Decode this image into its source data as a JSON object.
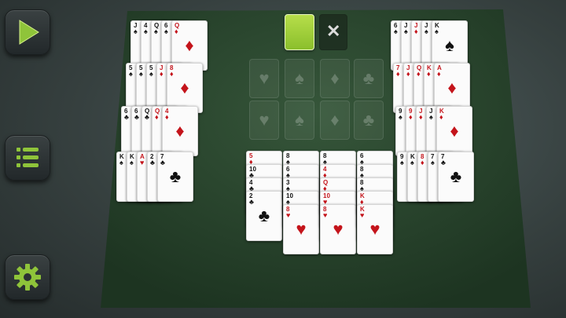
{
  "sidebar": {
    "buttons": [
      {
        "name": "play-button",
        "icon": "play-icon"
      },
      {
        "name": "menu-button",
        "icon": "list-icon"
      },
      {
        "name": "settings-button",
        "icon": "gear-icon"
      }
    ]
  },
  "colors": {
    "accent": "#8fc43a",
    "felt": "#2a4a2b",
    "card_red": "#c4141b"
  },
  "top_controls": {
    "deal_icon": "green-card-back-icon",
    "clear_icon": "close-icon",
    "clear_glyph": "✕"
  },
  "left_rows": [
    {
      "cards": [
        {
          "r": "J",
          "s": "♠"
        },
        {
          "r": "4",
          "s": "♠"
        },
        {
          "r": "Q",
          "s": "♠"
        },
        {
          "r": "6",
          "s": "♠"
        },
        {
          "r": "Q",
          "s": "♦"
        }
      ]
    },
    {
      "cards": [
        {
          "r": "5",
          "s": "♠"
        },
        {
          "r": "5",
          "s": "♠"
        },
        {
          "r": "5",
          "s": "♠"
        },
        {
          "r": "J",
          "s": "♦"
        },
        {
          "r": "8",
          "s": "♦"
        }
      ]
    },
    {
      "cards": [
        {
          "r": "6",
          "s": "♣"
        },
        {
          "r": "6",
          "s": "♣"
        },
        {
          "r": "Q",
          "s": "♣"
        },
        {
          "r": "Q",
          "s": "♦"
        },
        {
          "r": "4",
          "s": "♦"
        }
      ]
    },
    {
      "cards": [
        {
          "r": "K",
          "s": "♠"
        },
        {
          "r": "K",
          "s": "♠"
        },
        {
          "r": "A",
          "s": "♥"
        },
        {
          "r": "2",
          "s": "♣"
        },
        {
          "r": "7",
          "s": "♣"
        }
      ]
    }
  ],
  "right_rows": [
    {
      "cards": [
        {
          "r": "6",
          "s": "♠"
        },
        {
          "r": "J",
          "s": "♠"
        },
        {
          "r": "J",
          "s": "♦"
        },
        {
          "r": "J",
          "s": "♠"
        },
        {
          "r": "K",
          "s": "♠"
        }
      ]
    },
    {
      "cards": [
        {
          "r": "7",
          "s": "♦"
        },
        {
          "r": "J",
          "s": "♦"
        },
        {
          "r": "Q",
          "s": "♦"
        },
        {
          "r": "K",
          "s": "♦"
        },
        {
          "r": "A",
          "s": "♦"
        }
      ]
    },
    {
      "cards": [
        {
          "r": "9",
          "s": "♠"
        },
        {
          "r": "9",
          "s": "♦"
        },
        {
          "r": "J",
          "s": "♦"
        },
        {
          "r": "J",
          "s": "♠"
        },
        {
          "r": "K",
          "s": "♦"
        }
      ]
    },
    {
      "cards": [
        {
          "r": "9",
          "s": "♠"
        },
        {
          "r": "K",
          "s": "♠"
        },
        {
          "r": "8",
          "s": "♦"
        },
        {
          "r": "7",
          "s": "♠"
        },
        {
          "r": "7",
          "s": "♣"
        }
      ]
    }
  ],
  "foundation_slots": [
    "♥",
    "♠",
    "♦",
    "♣",
    "♥",
    "♠",
    "♦",
    "♣"
  ],
  "columns": [
    {
      "cards": [
        {
          "r": "5",
          "s": "♦"
        },
        {
          "r": "10",
          "s": "♣"
        },
        {
          "r": "4",
          "s": "♣"
        },
        {
          "r": "2",
          "s": "♣"
        }
      ]
    },
    {
      "cards": [
        {
          "r": "8",
          "s": "♠"
        },
        {
          "r": "6",
          "s": "♠"
        },
        {
          "r": "3",
          "s": "♠"
        },
        {
          "r": "10",
          "s": "♠"
        },
        {
          "r": "8",
          "s": "♥"
        }
      ]
    },
    {
      "cards": [
        {
          "r": "8",
          "s": "♠"
        },
        {
          "r": "4",
          "s": "♦"
        },
        {
          "r": "Q",
          "s": "♦"
        },
        {
          "r": "10",
          "s": "♥"
        },
        {
          "r": "8",
          "s": "♥"
        }
      ]
    },
    {
      "cards": [
        {
          "r": "6",
          "s": "♠"
        },
        {
          "r": "8",
          "s": "♠"
        },
        {
          "r": "8",
          "s": "♠"
        },
        {
          "r": "K",
          "s": "♦"
        },
        {
          "r": "K",
          "s": "♥"
        }
      ]
    }
  ]
}
